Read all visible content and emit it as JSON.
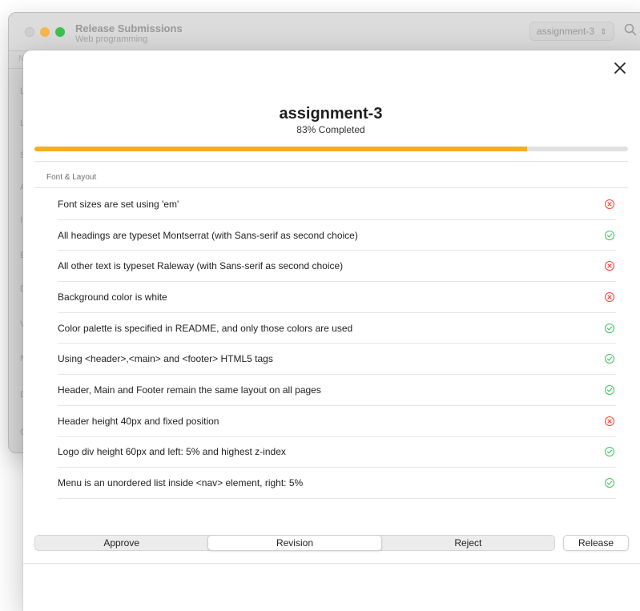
{
  "background_window": {
    "title": "Release Submissions",
    "subtitle": "Web programming",
    "selected_assignment": "assignment-3",
    "column_header": "N",
    "row_letters": [
      "L",
      "L",
      "S",
      "A",
      "I",
      "E",
      "D",
      "V",
      "N",
      "D",
      "C"
    ]
  },
  "sheet": {
    "title": "assignment-3",
    "progress_label": "83% Completed",
    "progress_fraction": 0.83,
    "section_label": "Font & Layout",
    "criteria": [
      {
        "text": "Font sizes are set using 'em'",
        "status": "fail"
      },
      {
        "text": "All headings are typeset Montserrat (with Sans-serif as second choice)",
        "status": "pass"
      },
      {
        "text": "All other text is typeset Raleway (with Sans-serif as second choice)",
        "status": "fail"
      },
      {
        "text": "Background color is white",
        "status": "fail"
      },
      {
        "text": "Color palette is specified in README, and only those colors are used",
        "status": "pass"
      },
      {
        "text": "Using <header>,<main> and <footer> HTML5 tags",
        "status": "pass"
      },
      {
        "text": "Header, Main and Footer remain the same layout on all pages",
        "status": "pass"
      },
      {
        "text": "Header height 40px and fixed position",
        "status": "fail"
      },
      {
        "text": "Logo div height 60px and left: 5% and highest z-index",
        "status": "pass"
      },
      {
        "text": "Menu is an unordered list inside <nav> element, right: 5%",
        "status": "pass"
      }
    ],
    "actions": {
      "approve": "Approve",
      "revision": "Revision",
      "reject": "Reject",
      "release": "Release",
      "selected": "revision"
    }
  },
  "colors": {
    "accent_progress": "#f5ae1e",
    "pass": "#34c759",
    "fail": "#ff3b30"
  },
  "icons": {
    "pass": "checkmark-circle-icon",
    "fail": "xmark-circle-icon",
    "close": "close-icon",
    "search": "search-icon"
  }
}
